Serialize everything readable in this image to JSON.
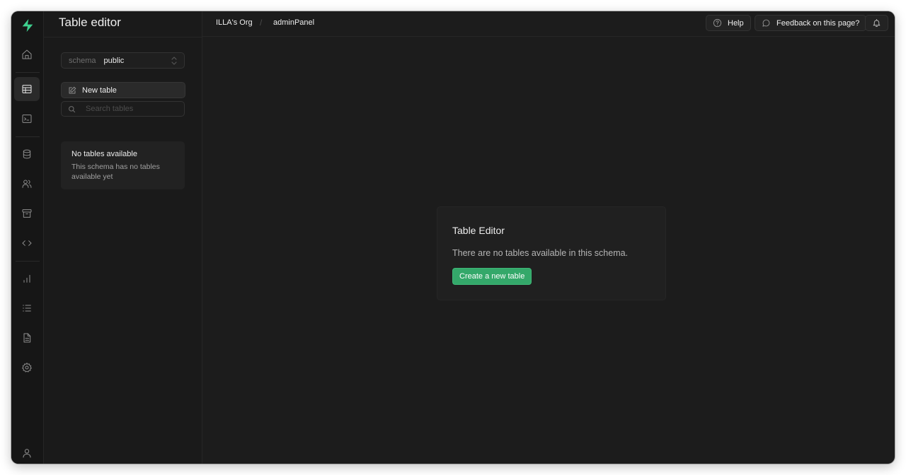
{
  "panel": {
    "title": "Table editor",
    "schema": {
      "label": "schema",
      "value": "public"
    },
    "new_table_label": "New table",
    "search_placeholder": "Search tables",
    "empty": {
      "title": "No tables available",
      "description": "This schema has no tables available yet"
    }
  },
  "topbar": {
    "breadcrumbs": [
      "ILLA's Org",
      "adminPanel"
    ],
    "separator": "/",
    "help_label": "Help",
    "feedback_label": "Feedback on this page?"
  },
  "main": {
    "card_title": "Table Editor",
    "card_description": "There are no tables available in this schema.",
    "cta_label": "Create a new table"
  },
  "rail": {
    "items": [
      "home-icon",
      "table-icon",
      "terminal-icon",
      "database-icon",
      "users-icon",
      "archive-icon",
      "code-icon",
      "bar-chart-icon",
      "list-icon",
      "file-icon",
      "settings-icon",
      "user-icon"
    ],
    "active": "table-icon"
  },
  "colors": {
    "brand": "#3ecf8e",
    "cta": "#34a86a",
    "background": "#1c1c1c"
  }
}
